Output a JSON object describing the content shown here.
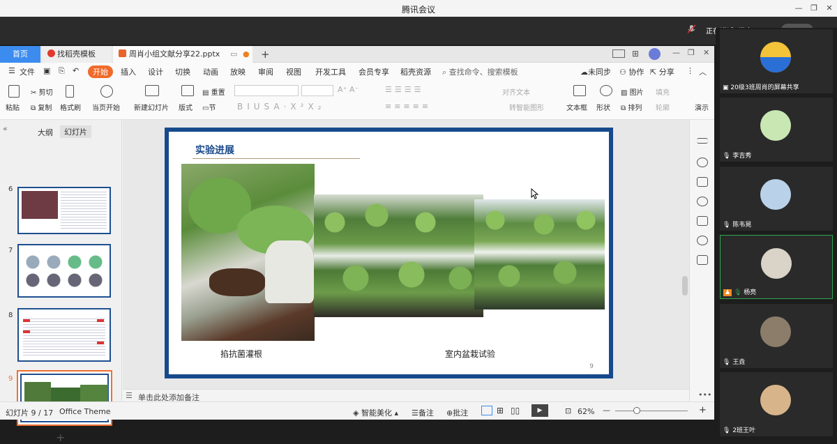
{
  "meeting": {
    "title": "腾讯会议",
    "speaking": "正在讲话: 杨亮;"
  },
  "tabs": {
    "home": "首页",
    "template": "找稻壳模板",
    "file": "周肖小组文献分享22.pptx",
    "new": "+"
  },
  "menu": {
    "file": "文件",
    "items": [
      "开始",
      "插入",
      "设计",
      "切换",
      "动画",
      "放映",
      "审阅",
      "视图",
      "开发工具",
      "会员专享",
      "稻壳资源"
    ],
    "search": "查找命令、搜索模板",
    "sync": "未同步",
    "collab": "协作",
    "share": "分享"
  },
  "ribbon": {
    "paste": "粘贴",
    "cut": "剪切",
    "copy": "复制",
    "format_painter": "格式刷",
    "from_current": "当页开始",
    "new_slide": "新建幻灯片",
    "layout": "版式",
    "section": "节",
    "reset": "重置",
    "align_text": "对齐文本",
    "smart_shape": "转智能图形",
    "textbox": "文本框",
    "shape": "形状",
    "picture": "图片",
    "fill": "填充",
    "arrange": "排列",
    "outline": "轮廓",
    "presenter": "演示"
  },
  "left_panel": {
    "outline_tab": "大纲",
    "slides_tab": "幻灯片",
    "thumb_numbers": [
      "6",
      "7",
      "8",
      "9"
    ],
    "add": "+"
  },
  "slide": {
    "title": "实验进展",
    "caption_left": "掐抗菌灌根",
    "caption_right": "室内盆栽试验",
    "number": "9"
  },
  "notes": {
    "placeholder": "单击此处添加备注"
  },
  "status": {
    "slide_counter": "幻灯片 9 / 17",
    "theme": "Office Theme",
    "smart_beautify": "智能美化",
    "notes": "备注",
    "comments": "批注",
    "zoom": "62%"
  },
  "participants": [
    {
      "name": "20级3班周肖的屏幕共享"
    },
    {
      "name": "李吉秀"
    },
    {
      "name": "陈韦晃"
    },
    {
      "name": "杨亮"
    },
    {
      "name": "王垚"
    },
    {
      "name": "2班王叶"
    }
  ],
  "colors": {
    "slide_border": "#174a8c",
    "accent_tab": "#3c8cf0",
    "start_btn": "#f06a2a",
    "active_speaker": "#2fa84f"
  }
}
